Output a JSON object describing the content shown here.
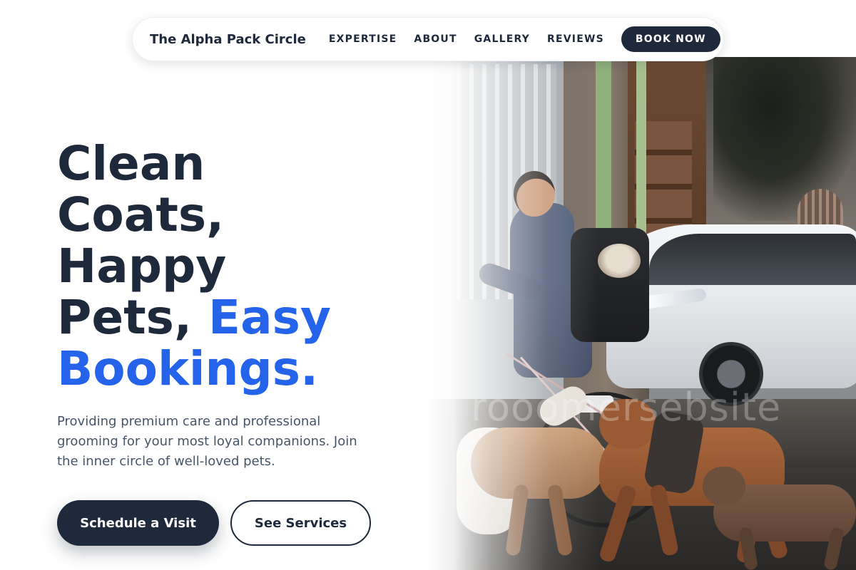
{
  "nav": {
    "brand": "The Alpha Pack Circle",
    "links": [
      "EXPERTISE",
      "ABOUT",
      "GALLERY",
      "REVIEWS"
    ],
    "cta": "BOOK NOW"
  },
  "hero": {
    "title_line1": "Clean",
    "title_line2": "Coats,",
    "title_line3": "Happy",
    "title_line4_plain": "Pets, ",
    "title_line4_accent": "Easy",
    "title_line5_accent": "Bookings.",
    "subtitle": "Providing premium care and professional grooming for your most loyal companions. Join the inner circle of well-loved pets.",
    "primary_button": "Schedule a Visit",
    "secondary_button": "See Services",
    "image_watermark": "rooomersebsite"
  },
  "colors": {
    "primary": "#1e293b",
    "accent": "#2563eb",
    "muted_text": "#475569",
    "background": "#ffffff"
  }
}
